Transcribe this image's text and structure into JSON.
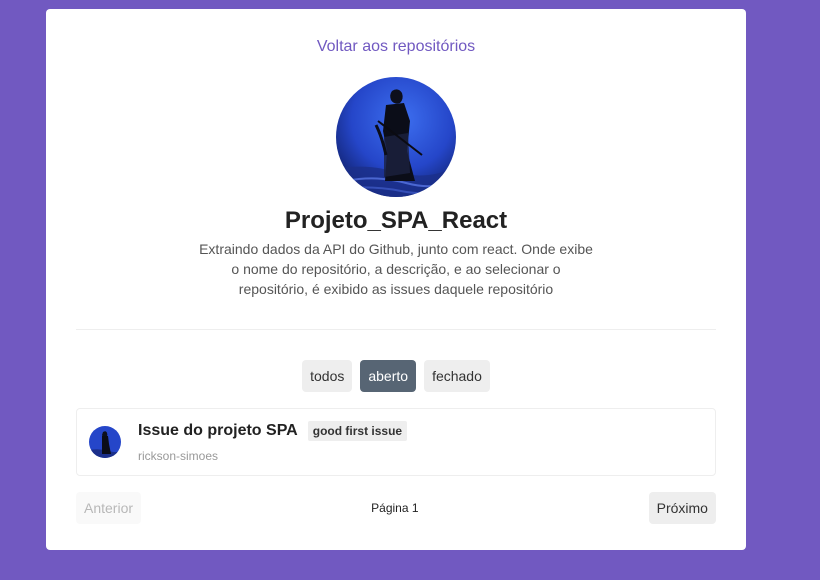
{
  "back_link": "Voltar aos repositórios",
  "repository": {
    "name": "Projeto_SPA_React",
    "description": "Extraindo dados da API do Github, junto com react. Onde exibe o nome do repositório, a descrição, e ao selecionar o repositório, é exibido as issues daquele repositório"
  },
  "filters": [
    {
      "label": "todos",
      "active": false
    },
    {
      "label": "aberto",
      "active": true
    },
    {
      "label": "fechado",
      "active": false
    }
  ],
  "issues": [
    {
      "title": "Issue do projeto SPA",
      "labels": [
        "good first issue"
      ],
      "author": "rickson-simoes"
    }
  ],
  "pagination": {
    "prev": "Anterior",
    "next": "Próximo",
    "page_text": "Página 1"
  },
  "colors": {
    "background": "#7159c1",
    "active_filter": "#576574",
    "link": "#7159c1"
  }
}
